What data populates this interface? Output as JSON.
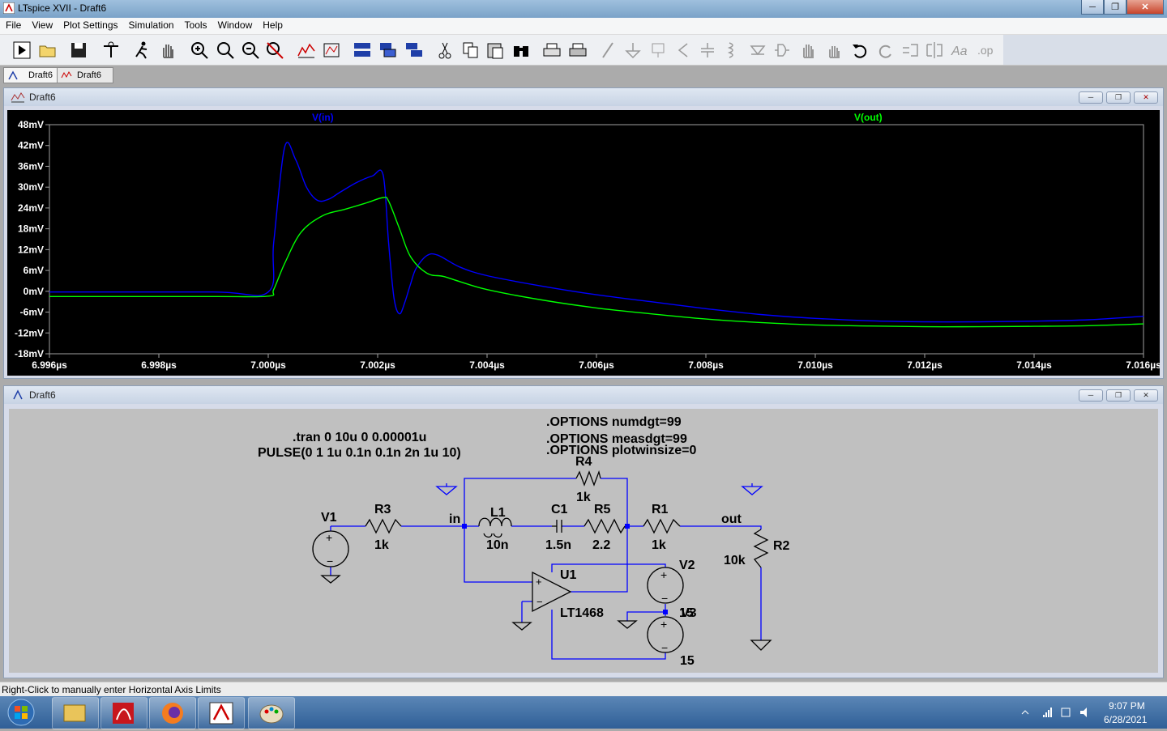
{
  "window": {
    "title": "LTspice XVII - Draft6"
  },
  "menu": [
    "File",
    "View",
    "Plot Settings",
    "Simulation",
    "Tools",
    "Window",
    "Help"
  ],
  "doc_tabs": [
    {
      "label": "Draft6"
    },
    {
      "label": "Draft6"
    }
  ],
  "plot_window": {
    "title": "Draft6"
  },
  "schematic_window": {
    "title": "Draft6"
  },
  "status_bar": {
    "text": "Right-Click to manually enter Horizontal Axis Limits"
  },
  "tray": {
    "time": "9:07 PM",
    "date": "6/28/2021"
  },
  "colors": {
    "vin": "#0000ff",
    "vout": "#00ff00",
    "wire": "#0000ff",
    "schem_bg": "#c0c0c0",
    "plot_bg": "#000000"
  },
  "chart_data": {
    "type": "line",
    "xlabel": "",
    "ylabel": "",
    "x_ticks": [
      "6.996µs",
      "6.998µs",
      "7.000µs",
      "7.002µs",
      "7.004µs",
      "7.006µs",
      "7.008µs",
      "7.010µs",
      "7.012µs",
      "7.014µs",
      "7.016µs"
    ],
    "y_ticks": [
      "48mV",
      "42mV",
      "36mV",
      "30mV",
      "24mV",
      "18mV",
      "12mV",
      "6mV",
      "0mV",
      "-6mV",
      "-12mV",
      "-18mV"
    ],
    "xlim": [
      6.996,
      7.016
    ],
    "ylim": [
      -18,
      48
    ],
    "series": [
      {
        "name": "V(in)",
        "color": "#0000ff",
        "x": [
          6.996,
          6.999,
          7.0,
          7.0001,
          7.0003,
          7.0005,
          7.0007,
          7.0009,
          7.0011,
          7.0013,
          7.0016,
          7.0019,
          7.0021,
          7.0022,
          7.0023,
          7.0024,
          7.0025,
          7.0026,
          7.0027,
          7.0029,
          7.0031,
          7.0035,
          7.004,
          7.005,
          7.006,
          7.007,
          7.008,
          7.009,
          7.01,
          7.011,
          7.012,
          7.013,
          7.014,
          7.015,
          7.016
        ],
        "y": [
          -0.2,
          -0.2,
          -0.2,
          14,
          41.5,
          38,
          30,
          26.2,
          26.5,
          28.4,
          31.2,
          33.2,
          33.5,
          14,
          -2,
          -6.5,
          -3,
          2,
          6.5,
          10.3,
          10.4,
          7,
          4.5,
          1.5,
          -1,
          -3,
          -5,
          -6.7,
          -7.8,
          -8.5,
          -8.8,
          -8.8,
          -8.6,
          -8.2,
          -7.2
        ]
      },
      {
        "name": "V(out)",
        "color": "#00ff00",
        "x": [
          6.996,
          6.999,
          7.0,
          7.0001,
          7.0003,
          7.0006,
          7.001,
          7.0014,
          7.0018,
          7.0021,
          7.0022,
          7.0024,
          7.0026,
          7.0029,
          7.0032,
          7.0035,
          7.004,
          7.005,
          7.006,
          7.007,
          7.008,
          7.009,
          7.01,
          7.011,
          7.012,
          7.013,
          7.014,
          7.015,
          7.016
        ],
        "y": [
          -1.5,
          -1.5,
          -1.4,
          0.5,
          8,
          17,
          21.8,
          23.6,
          25.5,
          27,
          26,
          18,
          10,
          5.2,
          4.3,
          2.8,
          0.5,
          -2.5,
          -4.8,
          -6.5,
          -8,
          -9,
          -9.7,
          -10,
          -10.2,
          -10.2,
          -10.1,
          -9.9,
          -9.4
        ]
      }
    ]
  },
  "schematic": {
    "directives": [
      ".tran 0 10u 0 0.00001u",
      "PULSE(0 1 1u 0.1n 0.1n 2n 1u 10)",
      ".OPTIONS numdgt=99",
      ".OPTIONS measdgt=99",
      ".OPTIONS plotwinsize=0"
    ],
    "labels": {
      "v1": "V1",
      "r3": "R3",
      "r3_val": "1k",
      "net_in": "in",
      "l1": "L1",
      "l1_val": "10n",
      "c1": "C1",
      "c1_val": "1.5n",
      "r5": "R5",
      "r5_val": "2.2",
      "r4": "R4",
      "r4_val": "1k",
      "r1": "R1",
      "r1_val": "1k",
      "net_out": "out",
      "r2": "R2",
      "r2_val": "10k",
      "u1": "U1",
      "u1_val": "LT1468",
      "v2": "V2",
      "v3": "V3",
      "v2_val": "15",
      "v3_val": "15"
    }
  }
}
